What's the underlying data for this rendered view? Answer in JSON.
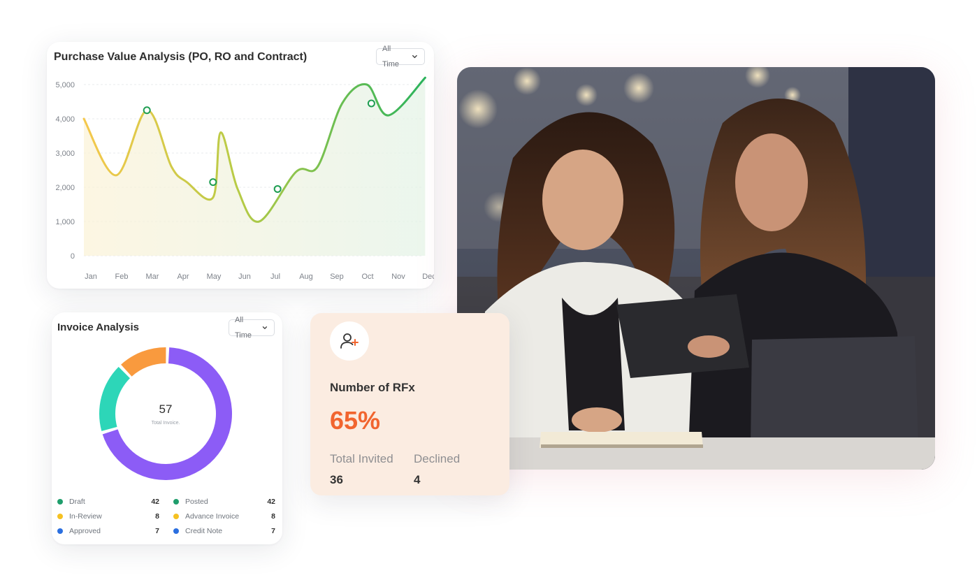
{
  "purchase": {
    "title": "Purchase Value Analysis (PO, RO and Contract)",
    "dropdown": "All Time",
    "chart_data": {
      "type": "line",
      "categories": [
        "Jan",
        "Feb",
        "Mar",
        "Apr",
        "May",
        "Jun",
        "Jul",
        "Aug",
        "Sep",
        "Oct",
        "Nov",
        "Dec"
      ],
      "y_ticks": [
        "5,000",
        "4,000",
        "3,000",
        "2,000",
        "1,000",
        "0"
      ],
      "ylim": [
        0,
        5000
      ],
      "grid": true,
      "series": [
        {
          "values": [
            4000,
            2350,
            4250,
            2600,
            2150,
            1700,
            3600,
            1950,
            1000,
            2450,
            2600,
            4450,
            5000,
            4100,
            5200
          ]
        }
      ],
      "x_positions": [
        0,
        1.05,
        2.05,
        2.85,
        3.35,
        4.2,
        4.45,
        5.0,
        5.7,
        6.9,
        7.6,
        8.4,
        9.2,
        9.9,
        11.1
      ],
      "markers": [
        {
          "x": 2.05,
          "y": 4250
        },
        {
          "x": 4.2,
          "y": 2150
        },
        {
          "x": 6.3,
          "y": 1950
        },
        {
          "x": 9.35,
          "y": 4450
        }
      ],
      "gradient_colors": [
        "#f5c84c",
        "#b8cb46",
        "#2bb35c"
      ]
    }
  },
  "invoice": {
    "title": "Invoice Analysis",
    "dropdown": "All Time",
    "chart_data": {
      "type": "pie",
      "center_value": "57",
      "center_label": "Total Invoice.",
      "slices": [
        {
          "value": 36,
          "color": "#8c5cf6"
        },
        {
          "value": 9,
          "color": "#2dd6b8"
        },
        {
          "value": 6.5,
          "color": "#f99a3e"
        }
      ]
    },
    "legend": [
      {
        "label": "Draft",
        "count": "42",
        "color": "#1f9e6c"
      },
      {
        "label": "Posted",
        "count": "42",
        "color": "#1f9e6c"
      },
      {
        "label": "In-Review",
        "count": "8",
        "color": "#f5c122"
      },
      {
        "label": "Advance Invoice",
        "count": "8",
        "color": "#f5c122"
      },
      {
        "label": "Approved",
        "count": "7",
        "color": "#2b6fe0"
      },
      {
        "label": "Credit Note",
        "count": "7",
        "color": "#2b6fe0"
      }
    ]
  },
  "rfx": {
    "icon": "user-plus-icon",
    "label": "Number of RFx",
    "percent": "65%",
    "stats": [
      {
        "label": "Total Invited",
        "value": "36"
      },
      {
        "label": "Declined",
        "value": "4"
      }
    ]
  }
}
